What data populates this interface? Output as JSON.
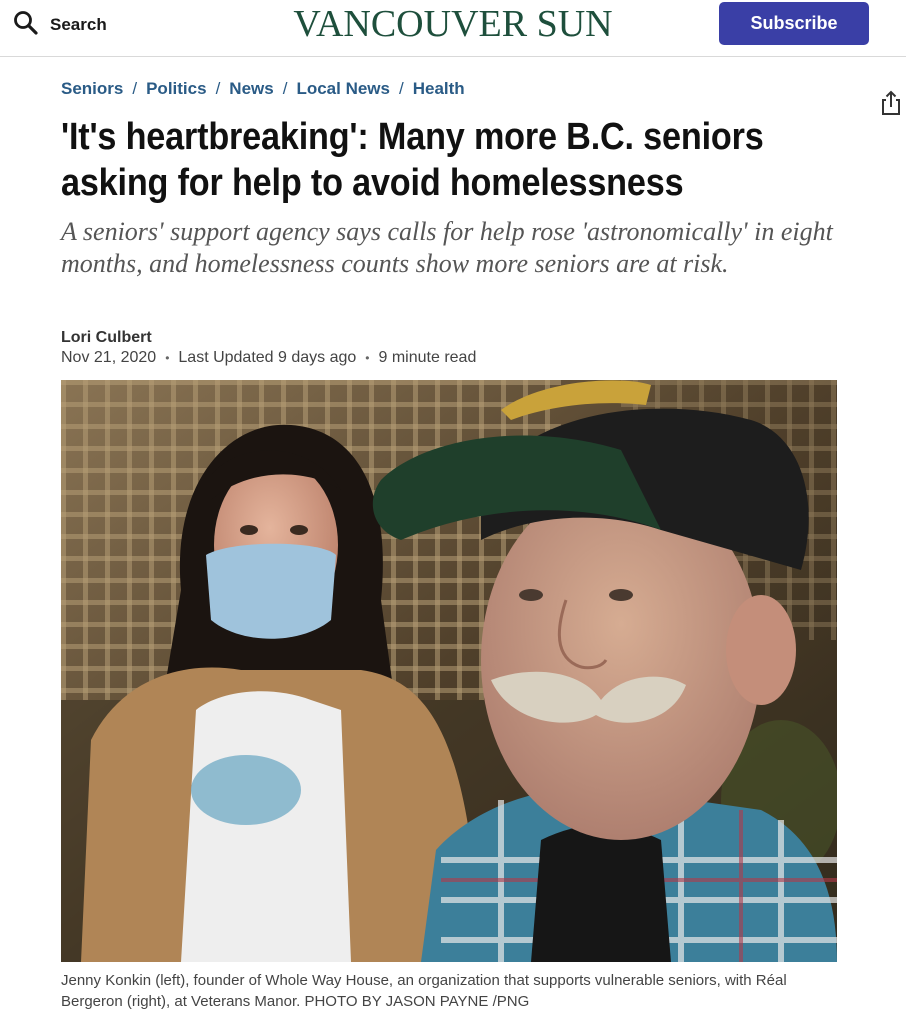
{
  "header": {
    "search_label": "Search",
    "logo_text": "VANCOUVER SUN",
    "subscribe_label": "Subscribe"
  },
  "breadcrumb": [
    "Seniors",
    "Politics",
    "News",
    "Local News",
    "Health"
  ],
  "breadcrumb_separator": "/",
  "article": {
    "headline": "'It's heartbreaking': Many more B.C. seniors asking for help to avoid homelessness",
    "deck": "A seniors' support agency says calls for help rose 'astronomically' in eight months, and homelessness counts show more seniors are at risk.",
    "author": "Lori Culbert",
    "date": "Nov 21, 2020",
    "last_updated": "Last Updated 9 days ago",
    "read_time": "9 minute read",
    "photo_caption": "Jenny Konkin (left), founder of Whole Way House, an organization that supports vulnerable seniors, with Réal Bergeron (right), at Veterans Manor. PHOTO BY JASON PAYNE /PNG"
  },
  "icons": {
    "search": "search-icon",
    "share": "share-icon"
  },
  "colors": {
    "brand": "#1e4f3c",
    "subscribe": "#3a3fa6",
    "link": "#2a5b86"
  }
}
